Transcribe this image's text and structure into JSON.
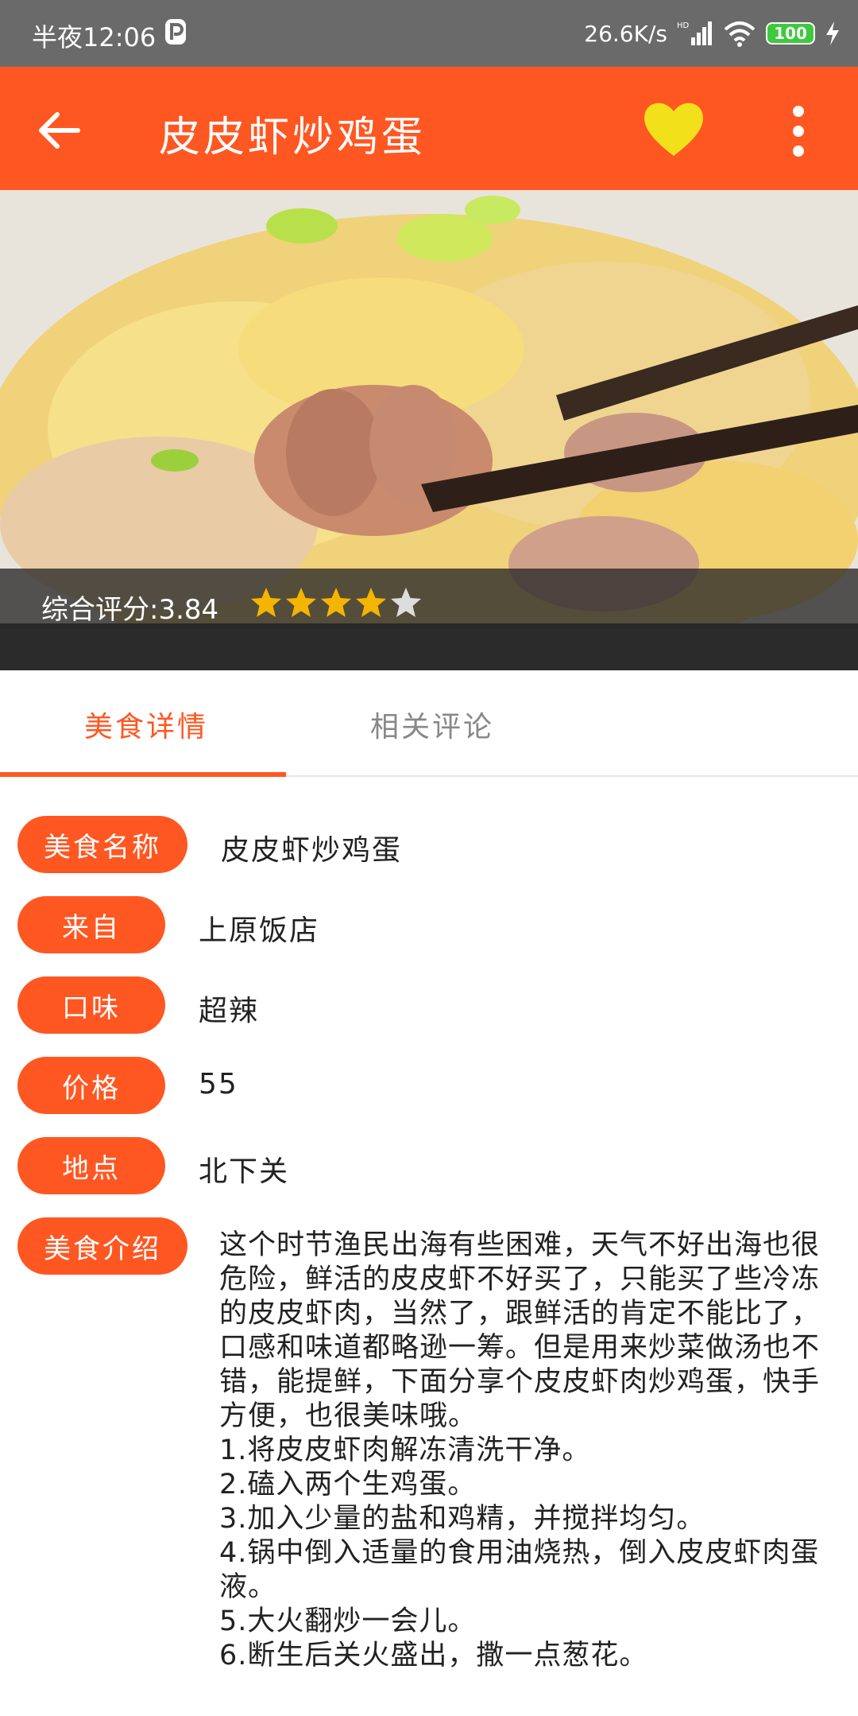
{
  "status_bar": {
    "time": "半夜12:06",
    "net_speed": "26.6K/s",
    "battery": "100"
  },
  "app_bar": {
    "title": "皮皮虾炒鸡蛋",
    "back_icon": "arrow-left-icon",
    "favorite_icon": "heart-icon",
    "more_icon": "more-vert-icon",
    "favorite_color": "#f2e01a"
  },
  "hero": {
    "rating_label": "综合评分:",
    "rating_value": "3.84",
    "stars_filled": 4,
    "stars_total": 5
  },
  "tabs": [
    {
      "label": "美食详情",
      "active": true
    },
    {
      "label": "相关评论",
      "active": false
    }
  ],
  "details": {
    "name_label": "美食名称",
    "name_value": "皮皮虾炒鸡蛋",
    "from_label": "来自",
    "from_value": "上原饭店",
    "taste_label": "口味",
    "taste_value": "超辣",
    "price_label": "价格",
    "price_value": "55",
    "location_label": "地点",
    "location_value": "北下关",
    "intro_label": "美食介绍",
    "intro_text": "这个时节渔民出海有些困难，天气不好出海也很危险，鲜活的皮皮虾不好买了，只能买了些冷冻的皮皮虾肉，当然了，跟鲜活的肯定不能比了，口感和味道都略逊一筹。但是用来炒菜做汤也不错，能提鲜，下面分享个皮皮虾肉炒鸡蛋，快手方便，也很美味哦。\n1.将皮皮虾肉解冻清洗干净。\n2.磕入两个生鸡蛋。\n3.加入少量的盐和鸡精，并搅拌均匀。\n4.锅中倒入适量的食用油烧热，倒入皮皮虾肉蛋液。\n5.大火翻炒一会儿。\n6.断生后关火盛出，撒一点葱花。"
  },
  "colors": {
    "accent": "#ff5722",
    "status_bar": "#6a6a6a",
    "star_filled": "#f5b400",
    "star_empty": "#dddddd"
  }
}
